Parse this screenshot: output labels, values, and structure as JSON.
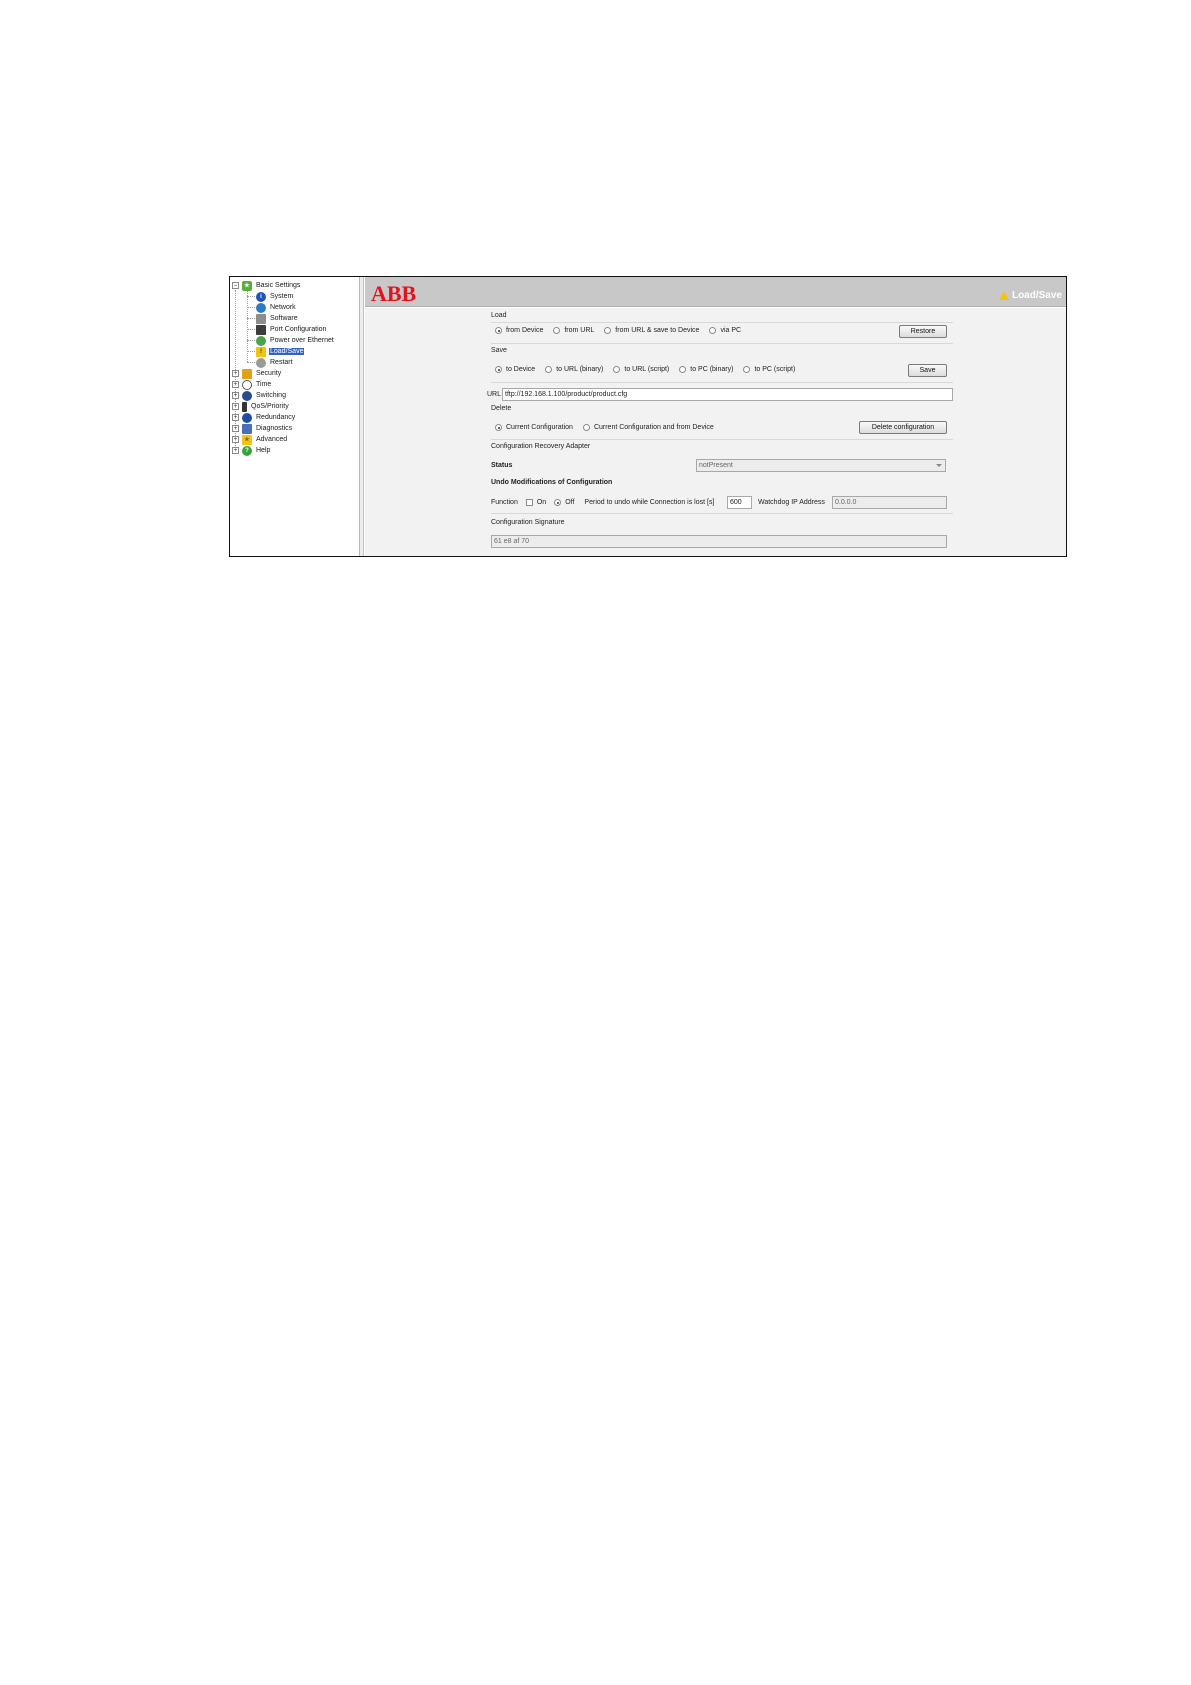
{
  "tree": {
    "root": {
      "label": "Basic Settings",
      "expander": "−",
      "icon": "star-icon"
    },
    "children": [
      {
        "label": "System",
        "icon": "info-icon"
      },
      {
        "label": "Network",
        "icon": "network-icon"
      },
      {
        "label": "Software",
        "icon": "software-icon"
      },
      {
        "label": "Port Configuration",
        "icon": "port-icon"
      },
      {
        "label": "Power over Ethernet",
        "icon": "poe-icon"
      },
      {
        "label": "Load/Save",
        "icon": "warning-icon",
        "selected": true
      },
      {
        "label": "Restart",
        "icon": "restart-icon"
      }
    ],
    "groups": [
      {
        "label": "Security",
        "expander": "+",
        "icon": "lock-icon"
      },
      {
        "label": "Time",
        "expander": "+",
        "icon": "clock-icon"
      },
      {
        "label": "Switching",
        "expander": "+",
        "icon": "switching-icon"
      },
      {
        "label": "QoS/Priority",
        "expander": "+",
        "icon": "qos-icon"
      },
      {
        "label": "Redundancy",
        "expander": "+",
        "icon": "redundancy-icon"
      },
      {
        "label": "Diagnostics",
        "expander": "+",
        "icon": "diagnostics-icon"
      },
      {
        "label": "Advanced",
        "expander": "+",
        "icon": "advanced-star-icon"
      },
      {
        "label": "Help",
        "expander": "+",
        "icon": "help-icon"
      }
    ]
  },
  "header": {
    "logo": "ABB",
    "title": "Load/Save",
    "title_icon": "warning-icon",
    "logo_color": "#e2141e"
  },
  "load": {
    "heading": "Load",
    "options": [
      "from Device",
      "from URL",
      "from URL & save to Device",
      "via PC"
    ],
    "selected": 0,
    "button": "Restore"
  },
  "save": {
    "heading": "Save",
    "options": [
      "to Device",
      "to URL (binary)",
      "to URL (script)",
      "to PC (binary)",
      "to PC (script)"
    ],
    "selected": 0,
    "button": "Save"
  },
  "url": {
    "label": "URL",
    "value": "tftp://192.168.1.100/product/product.cfg"
  },
  "delete": {
    "heading": "Delete",
    "options": [
      "Current Configuration",
      "Current Configuration and from Device"
    ],
    "selected": 0,
    "button": "Delete configuration"
  },
  "recovery": {
    "heading": "Configuration Recovery Adapter",
    "status_label": "Status",
    "status_value": "notPresent"
  },
  "undo": {
    "heading": "Undo Modifications of Configuration",
    "function_label": "Function",
    "on_label": "On",
    "off_label": "Off",
    "period_label": "Period to undo while Connection is lost [s]",
    "period_value": "600",
    "watchdog_label": "Watchdog IP Address",
    "watchdog_value": "0.0.0.0"
  },
  "signature": {
    "heading": "Configuration Signature",
    "value": "61 e8 af 70"
  }
}
